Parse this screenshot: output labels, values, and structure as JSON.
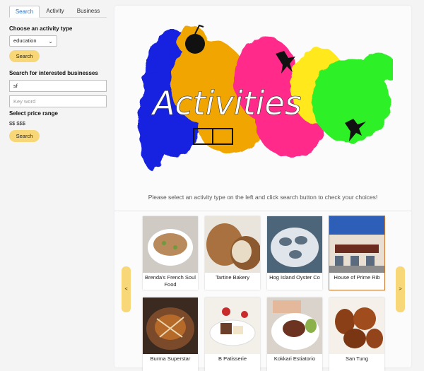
{
  "tabs": [
    "Search",
    "Activity",
    "Business"
  ],
  "activity": {
    "label": "Choose an activity type",
    "selected": "education",
    "search_label": "Search"
  },
  "business": {
    "label": "Search for interested businesses",
    "location_value": "sf",
    "keyword_placeholder": "Key word",
    "price_label": "Select price range",
    "price_value": "$$ $$$",
    "search_label": "Search"
  },
  "hero": {
    "word": "Activities"
  },
  "message": "Please select an activity type on the left and click search button to check your choices!",
  "carousel": {
    "prev": "<",
    "next": ">",
    "cards": [
      {
        "name": "Brenda's French Soul Food",
        "selected": false
      },
      {
        "name": "Tartine Bakery",
        "selected": false
      },
      {
        "name": "Hog Island Oyster Co",
        "selected": false
      },
      {
        "name": "House of Prime Rib",
        "selected": true
      },
      {
        "name": "Burma Superstar",
        "selected": false
      },
      {
        "name": "B Patisserie",
        "selected": false
      },
      {
        "name": "Kokkari Estiatorio",
        "selected": false
      },
      {
        "name": "San Tung",
        "selected": false
      }
    ]
  },
  "colors": {
    "accent_yellow": "#f7d778",
    "tab_active_text": "#2f6fbf",
    "selected_card_border": "#c87433"
  }
}
